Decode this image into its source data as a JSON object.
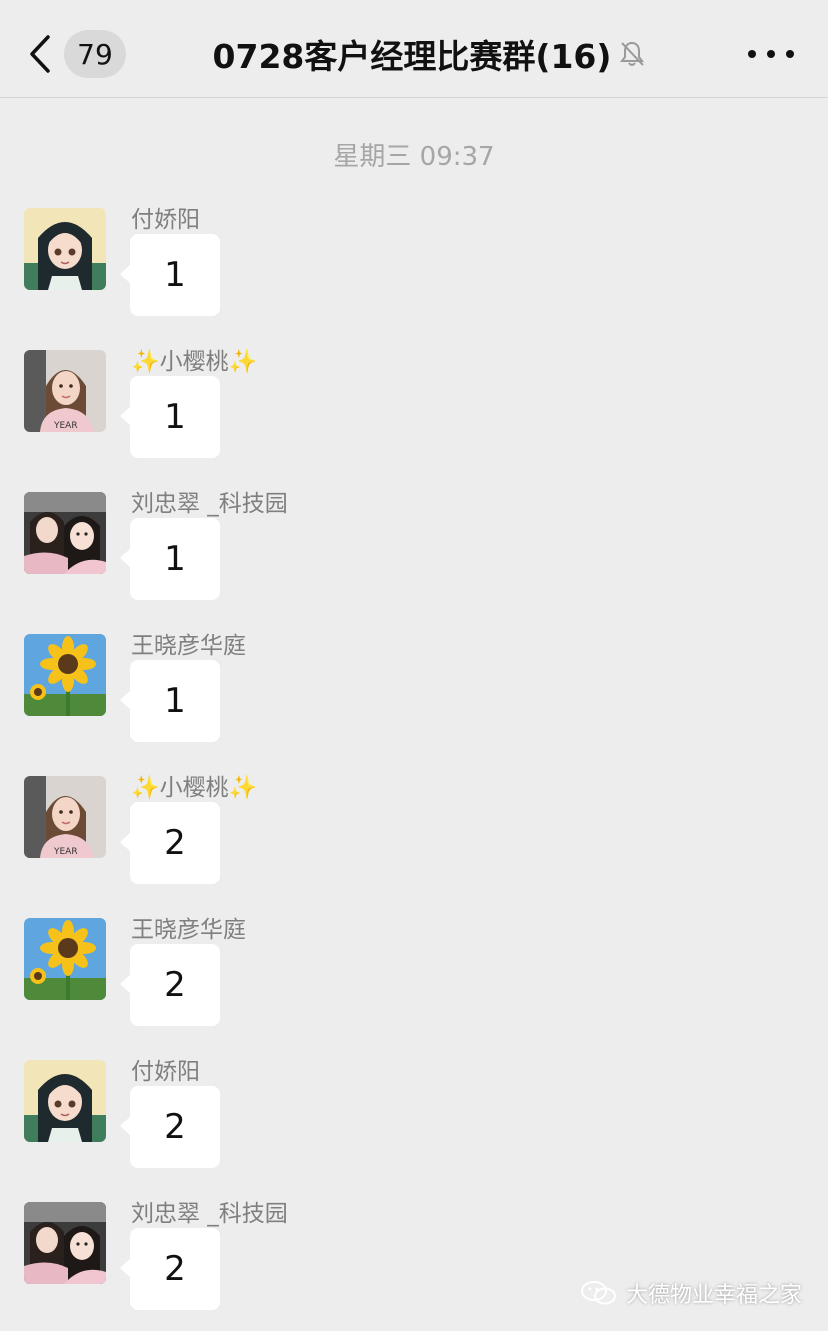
{
  "header": {
    "unread_count": "79",
    "title": "0728客户经理比赛群(16)",
    "back_icon": "chevron-left-icon",
    "mute_icon": "bell-off-icon",
    "more_icon": "more-dots-icon"
  },
  "timestamp": "星期三 09:37",
  "messages": [
    {
      "sender": "付娇阳",
      "text": "1",
      "avatar": "anime-girl"
    },
    {
      "sender": "✨小樱桃✨",
      "text": "1",
      "avatar": "woman-pink"
    },
    {
      "sender": "刘忠翠 _科技园",
      "text": "1",
      "avatar": "two-faces"
    },
    {
      "sender": "王晓彦华庭",
      "text": "1",
      "avatar": "sunflower"
    },
    {
      "sender": "✨小樱桃✨",
      "text": "2",
      "avatar": "woman-pink"
    },
    {
      "sender": "王晓彦华庭",
      "text": "2",
      "avatar": "sunflower"
    },
    {
      "sender": "付娇阳",
      "text": "2",
      "avatar": "anime-girl"
    },
    {
      "sender": "刘忠翠 _科技园",
      "text": "2",
      "avatar": "two-faces"
    }
  ],
  "watermark": {
    "text": "大德物业幸福之家",
    "icon": "wechat-icon"
  },
  "colors": {
    "background": "#ededed",
    "bubble": "#ffffff",
    "sender_name": "#7f7f7f",
    "timestamp": "#a6a6a6"
  }
}
